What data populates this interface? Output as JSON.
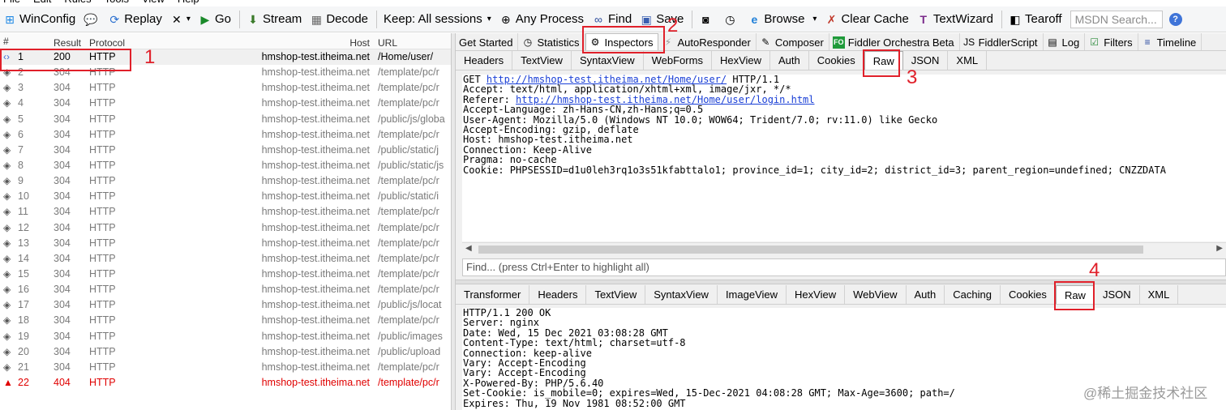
{
  "menu": [
    "File",
    "Edit",
    "Rules",
    "Tools",
    "View",
    "Help"
  ],
  "toolbar": {
    "items": [
      {
        "label": "WinConfig",
        "icon": "windows-icon"
      },
      {
        "label": "",
        "icon": "comment-icon"
      },
      {
        "label": "Replay",
        "icon": "replay-icon"
      },
      {
        "label": "",
        "icon": "remove-x-icon"
      },
      {
        "label": "Go",
        "icon": "play-icon"
      },
      {
        "label": "Stream",
        "icon": "stream-arrow-icon"
      },
      {
        "label": "Decode",
        "icon": "decode-grid-icon"
      },
      {
        "label": "Keep: All sessions",
        "icon": ""
      },
      {
        "label": "Any Process",
        "icon": "crosshair-icon"
      },
      {
        "label": "Find",
        "icon": "binoculars-icon"
      },
      {
        "label": "Save",
        "icon": "save-icon"
      },
      {
        "label": "",
        "icon": "camera-icon"
      },
      {
        "label": "",
        "icon": "timer-icon"
      },
      {
        "label": "Browse",
        "icon": "ie-icon"
      },
      {
        "label": "Clear Cache",
        "icon": "clear-cache-icon"
      },
      {
        "label": "TextWizard",
        "icon": "text-wizard-icon"
      },
      {
        "label": "Tearoff",
        "icon": "tearoff-icon"
      }
    ],
    "search_placeholder": "MSDN Search...",
    "help": "?"
  },
  "sessions": {
    "columns": {
      "num": "#",
      "result": "Result",
      "protocol": "Protocol",
      "host": "Host",
      "url": "URL"
    },
    "rows": [
      {
        "num": "1",
        "result": "200",
        "protocol": "HTTP",
        "host": "hmshop-test.itheima.net",
        "url": "/Home/user/",
        "state": "sel"
      },
      {
        "num": "2",
        "result": "304",
        "protocol": "HTTP",
        "host": "hmshop-test.itheima.net",
        "url": "/template/pc/r",
        "state": ""
      },
      {
        "num": "3",
        "result": "304",
        "protocol": "HTTP",
        "host": "hmshop-test.itheima.net",
        "url": "/template/pc/r",
        "state": ""
      },
      {
        "num": "4",
        "result": "304",
        "protocol": "HTTP",
        "host": "hmshop-test.itheima.net",
        "url": "/template/pc/r",
        "state": ""
      },
      {
        "num": "5",
        "result": "304",
        "protocol": "HTTP",
        "host": "hmshop-test.itheima.net",
        "url": "/public/js/globa",
        "state": ""
      },
      {
        "num": "6",
        "result": "304",
        "protocol": "HTTP",
        "host": "hmshop-test.itheima.net",
        "url": "/template/pc/r",
        "state": ""
      },
      {
        "num": "7",
        "result": "304",
        "protocol": "HTTP",
        "host": "hmshop-test.itheima.net",
        "url": "/public/static/j",
        "state": ""
      },
      {
        "num": "8",
        "result": "304",
        "protocol": "HTTP",
        "host": "hmshop-test.itheima.net",
        "url": "/public/static/js",
        "state": ""
      },
      {
        "num": "9",
        "result": "304",
        "protocol": "HTTP",
        "host": "hmshop-test.itheima.net",
        "url": "/template/pc/r",
        "state": ""
      },
      {
        "num": "10",
        "result": "304",
        "protocol": "HTTP",
        "host": "hmshop-test.itheima.net",
        "url": "/public/static/i",
        "state": ""
      },
      {
        "num": "11",
        "result": "304",
        "protocol": "HTTP",
        "host": "hmshop-test.itheima.net",
        "url": "/template/pc/r",
        "state": ""
      },
      {
        "num": "12",
        "result": "304",
        "protocol": "HTTP",
        "host": "hmshop-test.itheima.net",
        "url": "/template/pc/r",
        "state": ""
      },
      {
        "num": "13",
        "result": "304",
        "protocol": "HTTP",
        "host": "hmshop-test.itheima.net",
        "url": "/template/pc/r",
        "state": ""
      },
      {
        "num": "14",
        "result": "304",
        "protocol": "HTTP",
        "host": "hmshop-test.itheima.net",
        "url": "/template/pc/r",
        "state": ""
      },
      {
        "num": "15",
        "result": "304",
        "protocol": "HTTP",
        "host": "hmshop-test.itheima.net",
        "url": "/template/pc/r",
        "state": ""
      },
      {
        "num": "16",
        "result": "304",
        "protocol": "HTTP",
        "host": "hmshop-test.itheima.net",
        "url": "/template/pc/r",
        "state": ""
      },
      {
        "num": "17",
        "result": "304",
        "protocol": "HTTP",
        "host": "hmshop-test.itheima.net",
        "url": "/public/js/locat",
        "state": ""
      },
      {
        "num": "18",
        "result": "304",
        "protocol": "HTTP",
        "host": "hmshop-test.itheima.net",
        "url": "/template/pc/r",
        "state": ""
      },
      {
        "num": "19",
        "result": "304",
        "protocol": "HTTP",
        "host": "hmshop-test.itheima.net",
        "url": "/public/images",
        "state": ""
      },
      {
        "num": "20",
        "result": "304",
        "protocol": "HTTP",
        "host": "hmshop-test.itheima.net",
        "url": "/public/upload",
        "state": ""
      },
      {
        "num": "21",
        "result": "304",
        "protocol": "HTTP",
        "host": "hmshop-test.itheima.net",
        "url": "/template/pc/r",
        "state": ""
      },
      {
        "num": "22",
        "result": "404",
        "protocol": "HTTP",
        "host": "hmshop-test.itheima.net",
        "url": "/template/pc/r",
        "state": "err"
      }
    ]
  },
  "main_tabs": [
    {
      "label": "Get Started",
      "icon": "",
      "active": false
    },
    {
      "label": "Statistics",
      "icon": "stopwatch-icon",
      "active": false
    },
    {
      "label": "Inspectors",
      "icon": "inspectors-icon",
      "active": true
    },
    {
      "label": "AutoResponder",
      "icon": "lightning-icon",
      "active": false
    },
    {
      "label": "Composer",
      "icon": "composer-pencil-icon",
      "active": false
    },
    {
      "label": "Fiddler Orchestra Beta",
      "icon": "fo-icon",
      "active": false
    },
    {
      "label": "FiddlerScript",
      "icon": "script-icon",
      "active": false
    },
    {
      "label": "Log",
      "icon": "log-icon",
      "active": false
    },
    {
      "label": "Filters",
      "icon": "checkbox-icon",
      "active": false
    },
    {
      "label": "Timeline",
      "icon": "timeline-icon",
      "active": false
    }
  ],
  "request_tabs": [
    "Headers",
    "TextView",
    "SyntaxView",
    "WebForms",
    "HexView",
    "Auth",
    "Cookies",
    "Raw",
    "JSON",
    "XML"
  ],
  "request_active": "Raw",
  "request_raw": {
    "method": "GET ",
    "url": "http://hmshop-test.itheima.net/Home/user/",
    "version": " HTTP/1.1",
    "accept": "Accept: text/html, application/xhtml+xml, image/jxr, */*",
    "referer_key": "Referer: ",
    "referer_url": "http://hmshop-test.itheima.net/Home/user/login.html",
    "lines": [
      "Accept-Language: zh-Hans-CN,zh-Hans;q=0.5",
      "User-Agent: Mozilla/5.0 (Windows NT 10.0; WOW64; Trident/7.0; rv:11.0) like Gecko",
      "Accept-Encoding: gzip, deflate",
      "Host: hmshop-test.itheima.net",
      "Connection: Keep-Alive",
      "Pragma: no-cache",
      "Cookie: PHPSESSID=d1u0leh3rq1o3s51kfabttalo1; province_id=1; city_id=2; district_id=3; parent_region=undefined; CNZZDATA"
    ]
  },
  "find_placeholder": "Find... (press Ctrl+Enter to highlight all)",
  "response_tabs": [
    "Transformer",
    "Headers",
    "TextView",
    "SyntaxView",
    "ImageView",
    "HexView",
    "WebView",
    "Auth",
    "Caching",
    "Cookies",
    "Raw",
    "JSON",
    "XML"
  ],
  "response_active": "Raw",
  "response_raw": [
    "HTTP/1.1 200 OK",
    "Server: nginx",
    "Date: Wed, 15 Dec 2021 03:08:28 GMT",
    "Content-Type: text/html; charset=utf-8",
    "Connection: keep-alive",
    "Vary: Accept-Encoding",
    "Vary: Accept-Encoding",
    "X-Powered-By: PHP/5.6.40",
    "Set-Cookie: is_mobile=0; expires=Wed, 15-Dec-2021 04:08:28 GMT; Max-Age=3600; path=/",
    "Expires: Thu, 19 Nov 1981 08:52:00 GMT"
  ],
  "annotations": [
    "1",
    "2",
    "3",
    "4"
  ],
  "watermark": "@稀土掘金技术社区",
  "colors": {
    "annotation": "#e0202a",
    "error_row": "#e00000",
    "link": "#1a3fd6"
  }
}
